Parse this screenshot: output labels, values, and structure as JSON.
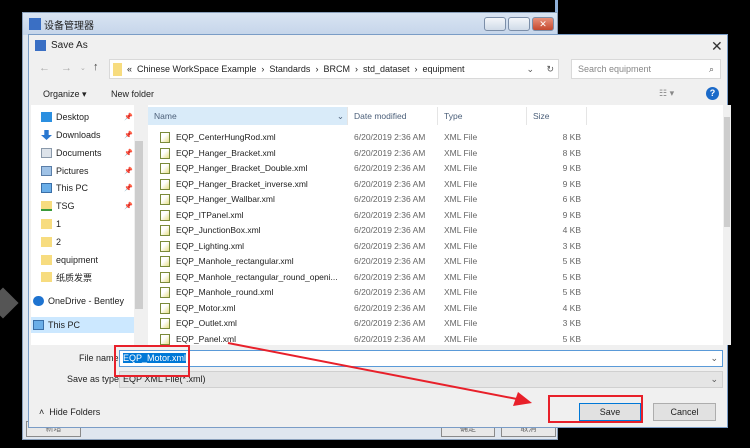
{
  "parent_window": {
    "title": "设备管理器",
    "buttons": [
      "新增",
      "确定",
      "取消"
    ]
  },
  "dialog": {
    "title": "Save As",
    "address": {
      "prefix": "«",
      "crumbs": [
        "Chinese WorkSpace Example",
        "Standards",
        "BRCM",
        "std_dataset",
        "equipment"
      ]
    },
    "search_placeholder": "Search equipment",
    "toolbar": {
      "organize": "Organize ▾",
      "new_folder": "New folder"
    },
    "nav": [
      {
        "label": "Desktop",
        "icon": "desktop-icon",
        "pinned": true
      },
      {
        "label": "Downloads",
        "icon": "download-icon",
        "pinned": true
      },
      {
        "label": "Documents",
        "icon": "documents-icon",
        "pinned": true
      },
      {
        "label": "Pictures",
        "icon": "pictures-icon",
        "pinned": true
      },
      {
        "label": "This PC",
        "icon": "computer-icon",
        "pinned": true
      },
      {
        "label": "TSG",
        "icon": "network-folder-icon",
        "pinned": true
      },
      {
        "label": "1",
        "icon": "folder-icon"
      },
      {
        "label": "2",
        "icon": "folder-icon"
      },
      {
        "label": "equipment",
        "icon": "folder-icon"
      },
      {
        "label": "纸质发票",
        "icon": "folder-icon"
      },
      {
        "label": "OneDrive - Bentley",
        "icon": "onedrive-icon"
      },
      {
        "label": "This PC",
        "icon": "computer-icon",
        "selected": true
      }
    ],
    "columns": [
      "Name",
      "Date modified",
      "Type",
      "Size"
    ],
    "files": [
      [
        "EQP_CenterHungRod.xml",
        "6/20/2019 2:36 AM",
        "XML File",
        "8 KB"
      ],
      [
        "EQP_Hanger_Bracket.xml",
        "6/20/2019 2:36 AM",
        "XML File",
        "8 KB"
      ],
      [
        "EQP_Hanger_Bracket_Double.xml",
        "6/20/2019 2:36 AM",
        "XML File",
        "9 KB"
      ],
      [
        "EQP_Hanger_Bracket_inverse.xml",
        "6/20/2019 2:36 AM",
        "XML File",
        "9 KB"
      ],
      [
        "EQP_Hanger_Wallbar.xml",
        "6/20/2019 2:36 AM",
        "XML File",
        "6 KB"
      ],
      [
        "EQP_ITPanel.xml",
        "6/20/2019 2:36 AM",
        "XML File",
        "9 KB"
      ],
      [
        "EQP_JunctionBox.xml",
        "6/20/2019 2:36 AM",
        "XML File",
        "4 KB"
      ],
      [
        "EQP_Lighting.xml",
        "6/20/2019 2:36 AM",
        "XML File",
        "3 KB"
      ],
      [
        "EQP_Manhole_rectangular.xml",
        "6/20/2019 2:36 AM",
        "XML File",
        "5 KB"
      ],
      [
        "EQP_Manhole_rectangular_round_openi...",
        "6/20/2019 2:36 AM",
        "XML File",
        "5 KB"
      ],
      [
        "EQP_Manhole_round.xml",
        "6/20/2019 2:36 AM",
        "XML File",
        "5 KB"
      ],
      [
        "EQP_Motor.xml",
        "6/20/2019 2:36 AM",
        "XML File",
        "4 KB"
      ],
      [
        "EQP_Outlet.xml",
        "6/20/2019 2:36 AM",
        "XML File",
        "3 KB"
      ],
      [
        "EQP_Panel.xml",
        "6/20/2019 2:36 AM",
        "XML File",
        "5 KB"
      ]
    ],
    "file_name_label": "File name:",
    "file_name_value": "EQP_Motor.xml",
    "save_type_label": "Save as type:",
    "save_type_value": "EQP XML File(*.xml)",
    "hide_folders": "Hide Folders",
    "save": "Save",
    "cancel": "Cancel"
  },
  "colors": {
    "accent": "#0078d7",
    "annotation": "#e8202a",
    "selection": "#cce8ff"
  }
}
